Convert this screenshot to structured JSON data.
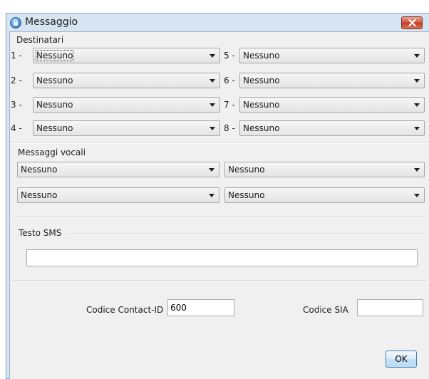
{
  "window": {
    "title": "Messaggio",
    "icon": "lock-icon",
    "close_icon": "close-icon",
    "title_color": "#1d1d1d",
    "close_color": "#c43b23"
  },
  "destinatari": {
    "label": "Destinatari",
    "items": [
      {
        "num": "1 -",
        "value": "Nessuno"
      },
      {
        "num": "2 -",
        "value": "Nessuno"
      },
      {
        "num": "3 -",
        "value": "Nessuno"
      },
      {
        "num": "4 -",
        "value": "Nessuno"
      },
      {
        "num": "5 -",
        "value": "Nessuno"
      },
      {
        "num": "6 -",
        "value": "Nessuno"
      },
      {
        "num": "7 -",
        "value": "Nessuno"
      },
      {
        "num": "8 -",
        "value": "Nessuno"
      }
    ]
  },
  "messaggi_vocali": {
    "label": "Messaggi vocali",
    "items": [
      {
        "value": "Nessuno"
      },
      {
        "value": "Nessuno"
      },
      {
        "value": "Nessuno"
      },
      {
        "value": "Nessuno"
      }
    ]
  },
  "sms": {
    "label": "Testo SMS",
    "value": ""
  },
  "codes": {
    "contact_id_label": "Codice Contact-ID",
    "contact_id_value": "600",
    "sia_label": "Codice SIA",
    "sia_value": ""
  },
  "ok_label": "OK"
}
